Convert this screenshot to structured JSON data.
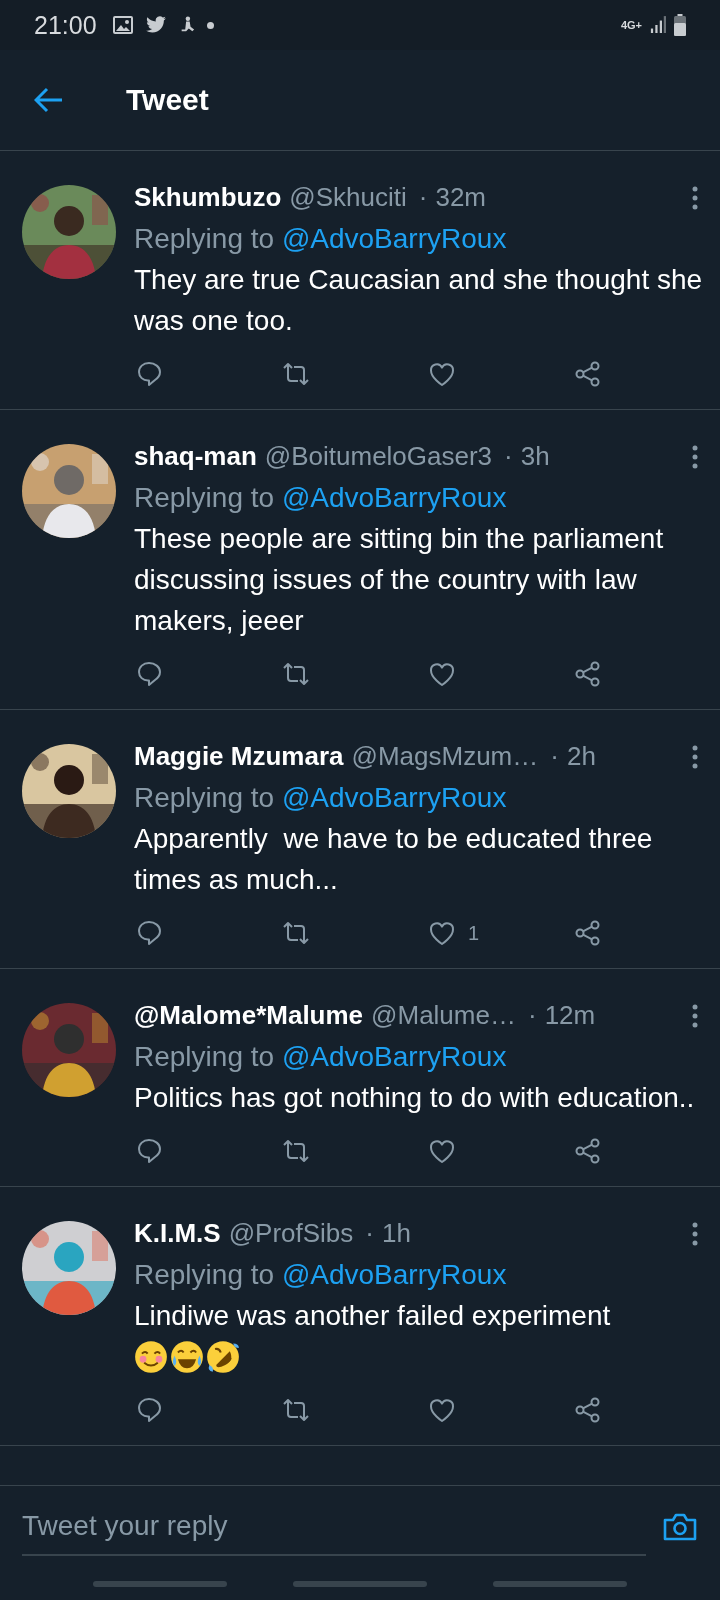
{
  "status_bar": {
    "time": "21:00",
    "network": "4G+"
  },
  "header": {
    "title": "Tweet"
  },
  "tweets": [
    {
      "name": "Skhumbuzo",
      "handle": "@Skhuciti",
      "separator": "·",
      "time": "32m",
      "replying_prefix": "Replying to",
      "reply_to": "@AdvoBarryRoux",
      "text": "They are true Caucasian and she thought she was one too."
    },
    {
      "name": "shaq-man",
      "handle": "@BoitumeloGaser3",
      "separator": "·",
      "time": "3h",
      "replying_prefix": "Replying to",
      "reply_to": "@AdvoBarryRoux",
      "text": "These people are sitting bin the parliament discussing issues of the country with law makers, jeeer"
    },
    {
      "name": "Maggie Mzumara",
      "handle": "@MagsMzum…",
      "separator": "·",
      "time": "2h",
      "replying_prefix": "Replying to",
      "reply_to": "@AdvoBarryRoux",
      "text": "Apparently  we have to be educated three times as much...",
      "likes": "1"
    },
    {
      "name": "@Malome*Malume",
      "handle": "@Malume…",
      "separator": "·",
      "time": "12m",
      "replying_prefix": "Replying to",
      "reply_to": "@AdvoBarryRoux",
      "text": "Politics has got nothing to do with education.."
    },
    {
      "name": "K.I.M.S",
      "handle": "@ProfSibs",
      "separator": "·",
      "time": "1h",
      "replying_prefix": "Replying to",
      "reply_to": "@AdvoBarryRoux",
      "text": "Lindiwe was another failed experiment",
      "emoji": [
        {
          "kind": "blush"
        },
        {
          "kind": "joy"
        },
        {
          "kind": "rofl"
        }
      ]
    }
  ],
  "reply_bar": {
    "placeholder": "Tweet your reply"
  }
}
